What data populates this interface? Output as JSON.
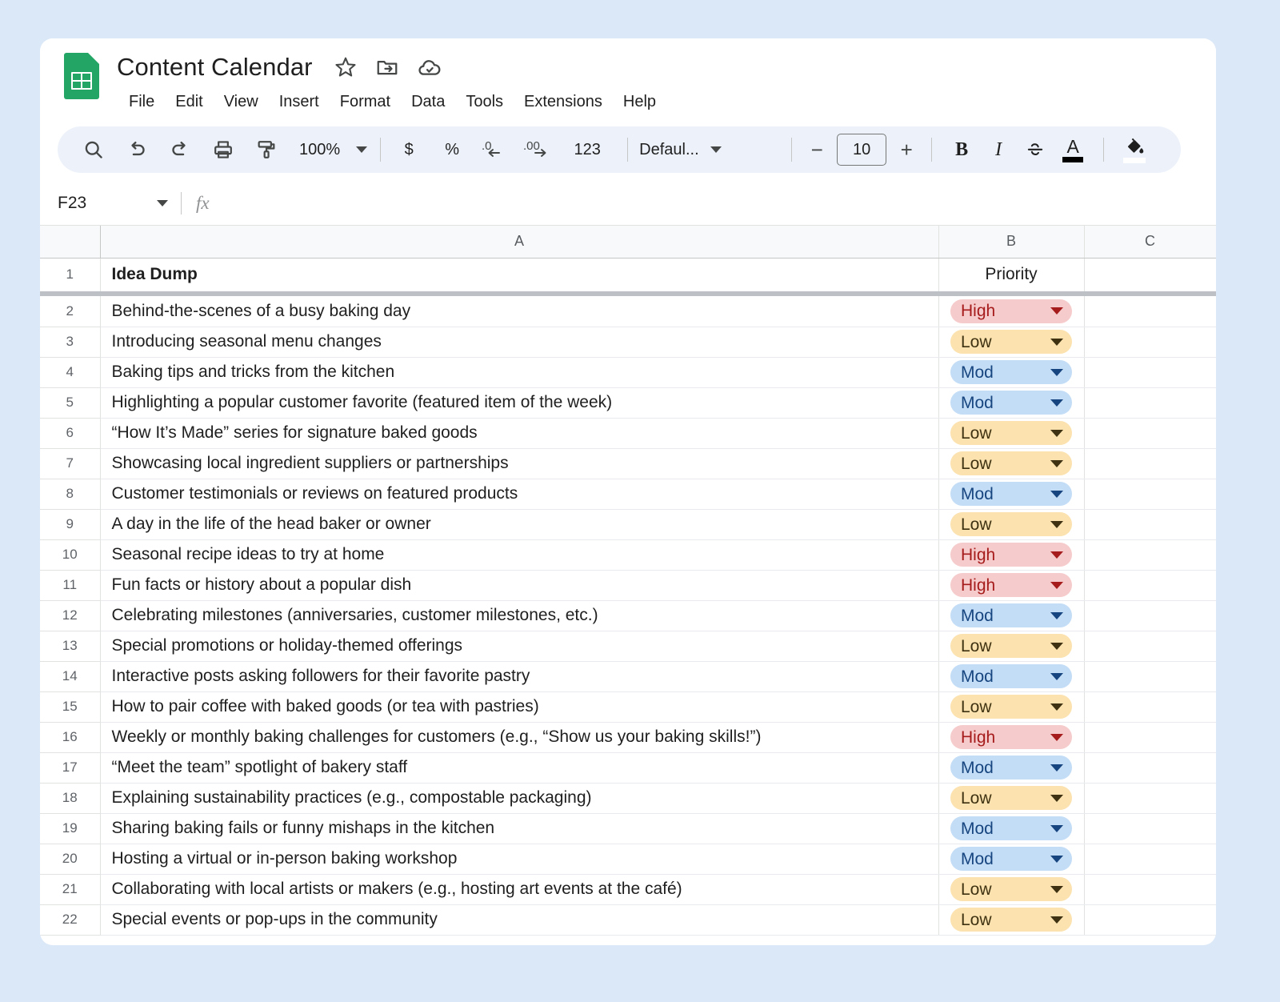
{
  "app": {
    "doc_title": "Content Calendar",
    "logo_name": "google-sheets-logo",
    "title_icons": [
      "star-icon",
      "move-to-folder-icon",
      "cloud-saved-icon"
    ]
  },
  "menubar": {
    "items": [
      "File",
      "Edit",
      "View",
      "Insert",
      "Format",
      "Data",
      "Tools",
      "Extensions",
      "Help"
    ]
  },
  "toolbar": {
    "search": "search-icon",
    "undo": "undo-icon",
    "redo": "redo-icon",
    "print": "print-icon",
    "paint_format": "paint-format-icon",
    "zoom_value": "100%",
    "currency": "$",
    "percent": "%",
    "decrease_decimal": ".0",
    "increase_decimal": ".00",
    "more_formats": "123",
    "font_name": "Defaul...",
    "font_size_decrease": "−",
    "font_size": "10",
    "font_size_increase": "+",
    "bold": "B",
    "italic": "I",
    "strikethrough": "S",
    "text_color": "A",
    "fill_color": "fill-color-icon"
  },
  "formula_bar": {
    "name_box": "F23",
    "fx_label": "fx",
    "formula_value": ""
  },
  "grid": {
    "column_headers": [
      "A",
      "B",
      "C"
    ],
    "header_row": {
      "num": "1",
      "a": "Idea Dump",
      "b": "Priority",
      "c": ""
    },
    "rows": [
      {
        "num": "2",
        "idea": "Behind-the-scenes of a busy baking day",
        "priority": "High",
        "level": "high"
      },
      {
        "num": "3",
        "idea": "Introducing seasonal menu changes",
        "priority": "Low",
        "level": "low"
      },
      {
        "num": "4",
        "idea": "Baking tips and tricks from the kitchen",
        "priority": "Mod",
        "level": "mod"
      },
      {
        "num": "5",
        "idea": "Highlighting a popular customer favorite (featured item of the week)",
        "priority": "Mod",
        "level": "mod"
      },
      {
        "num": "6",
        "idea": "“How It’s Made” series for signature baked goods",
        "priority": "Low",
        "level": "low"
      },
      {
        "num": "7",
        "idea": "Showcasing local ingredient suppliers or partnerships",
        "priority": "Low",
        "level": "low"
      },
      {
        "num": "8",
        "idea": "Customer testimonials or reviews on featured products",
        "priority": "Mod",
        "level": "mod"
      },
      {
        "num": "9",
        "idea": "A day in the life of the head baker or owner",
        "priority": "Low",
        "level": "low"
      },
      {
        "num": "10",
        "idea": "Seasonal recipe ideas to try at home",
        "priority": "High",
        "level": "high"
      },
      {
        "num": "11",
        "idea": "Fun facts or history about a popular dish",
        "priority": "High",
        "level": "high"
      },
      {
        "num": "12",
        "idea": "Celebrating milestones (anniversaries, customer milestones, etc.)",
        "priority": "Mod",
        "level": "mod"
      },
      {
        "num": "13",
        "idea": "Special promotions or holiday-themed offerings",
        "priority": "Low",
        "level": "low"
      },
      {
        "num": "14",
        "idea": "Interactive posts asking followers for their favorite pastry",
        "priority": "Mod",
        "level": "mod"
      },
      {
        "num": "15",
        "idea": "How to pair coffee with baked goods (or tea with pastries)",
        "priority": "Low",
        "level": "low"
      },
      {
        "num": "16",
        "idea": "Weekly or monthly baking challenges for customers (e.g., “Show us your baking skills!”)",
        "priority": "High",
        "level": "high"
      },
      {
        "num": "17",
        "idea": "“Meet the team” spotlight of bakery staff",
        "priority": "Mod",
        "level": "mod"
      },
      {
        "num": "18",
        "idea": "Explaining sustainability practices (e.g., compostable packaging)",
        "priority": "Low",
        "level": "low"
      },
      {
        "num": "19",
        "idea": "Sharing baking fails or funny mishaps in the kitchen",
        "priority": "Mod",
        "level": "mod"
      },
      {
        "num": "20",
        "idea": "Hosting a virtual or in-person baking workshop",
        "priority": "Mod",
        "level": "mod"
      },
      {
        "num": "21",
        "idea": "Collaborating with local artists or makers (e.g., hosting art events at the café)",
        "priority": "Low",
        "level": "low"
      },
      {
        "num": "22",
        "idea": "Special events or pop-ups in the community",
        "priority": "Low",
        "level": "low"
      }
    ]
  },
  "colors": {
    "page_background": "#dbe8f8",
    "sheets_green": "#23a566",
    "toolbar_background": "#edf2fa",
    "chip_high_bg": "#f6cbcb",
    "chip_high_text": "#a61c1c",
    "chip_low_bg": "#fbe2ae",
    "chip_low_text": "#3f3212",
    "chip_mod_bg": "#c3ddf6",
    "chip_mod_text": "#17457f"
  }
}
